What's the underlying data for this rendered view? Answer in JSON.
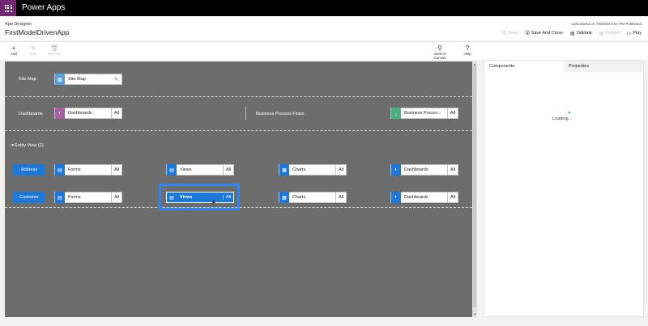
{
  "topbar": {
    "app_name": "Power Apps"
  },
  "header": {
    "designer_label": "App Designer",
    "app_title": "FirstModelDrivenApp",
    "last_saved": "Last Saved on 7/9/2020 9:57 PM Published",
    "actions": [
      {
        "label": "Save",
        "icon": "save-icon",
        "enabled": false
      },
      {
        "label": "Save And Close",
        "icon": "save-close-icon",
        "enabled": true
      },
      {
        "label": "Validate",
        "icon": "validate-icon",
        "enabled": true
      },
      {
        "label": "Publish",
        "icon": "publish-icon",
        "enabled": false
      },
      {
        "label": "Play",
        "icon": "play-icon",
        "enabled": true
      }
    ]
  },
  "toolbar": {
    "add": "Add",
    "edit": "Edit",
    "remove": "Remove",
    "search_canvas": "Search Canvas",
    "help": "Help"
  },
  "canvas": {
    "sitemap_label": "Site Map",
    "sitemap_tile": "Site Map",
    "dashboards_label": "Dashboards",
    "dashboards_tile": "Dashboards",
    "dashboards_all": "All",
    "bpf_label": "Business Process Flows",
    "bpf_tile": "Business Proces...",
    "bpf_all": "All",
    "entity_view_label": "Entity View (2)",
    "entities": [
      {
        "name": "Address",
        "forms": "Forms",
        "forms_all": "All",
        "views": "Views",
        "views_all": "All",
        "charts": "Charts",
        "charts_all": "All",
        "dashboards": "Dashboards",
        "dashboards_all": "All"
      },
      {
        "name": "Customer",
        "forms": "Forms",
        "forms_all": "All",
        "views": "Views",
        "views_all": "All",
        "charts": "Charts",
        "charts_all": "All",
        "dashboards": "Dashboards",
        "dashboards_all": "All"
      }
    ]
  },
  "side_panel": {
    "tabs": [
      "Components",
      "Properties"
    ],
    "loading_text": "Loading..."
  },
  "colors": {
    "brand": "#742774",
    "accent": "#1e78d7",
    "canvas_bg": "#6d6d6d",
    "selection": "#2d86ff"
  }
}
